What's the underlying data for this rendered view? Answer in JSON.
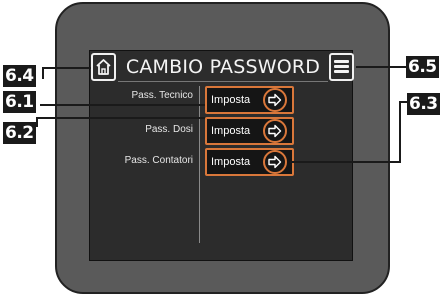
{
  "screen": {
    "title": "CAMBIO PASSWORD",
    "home_icon": "home-icon",
    "menu_icon": "hamburger-menu-icon"
  },
  "rows": [
    {
      "label": "Pass. Tecnico",
      "button_label": "Imposta",
      "icon": "arrow-right-icon"
    },
    {
      "label": "Pass. Dosi",
      "button_label": "Imposta",
      "icon": "arrow-right-icon"
    },
    {
      "label": "Pass. Contatori",
      "button_label": "Imposta",
      "icon": "arrow-right-icon"
    }
  ],
  "callouts": {
    "home": "6.4",
    "menu": "6.5",
    "row1": "6.1",
    "row2": "6.2",
    "row3": "6.3"
  },
  "colors": {
    "accent": "#d9773a",
    "screen_bg": "#2c2c2c",
    "bezel": "#5a5a5a",
    "text": "#f4f4f4"
  }
}
